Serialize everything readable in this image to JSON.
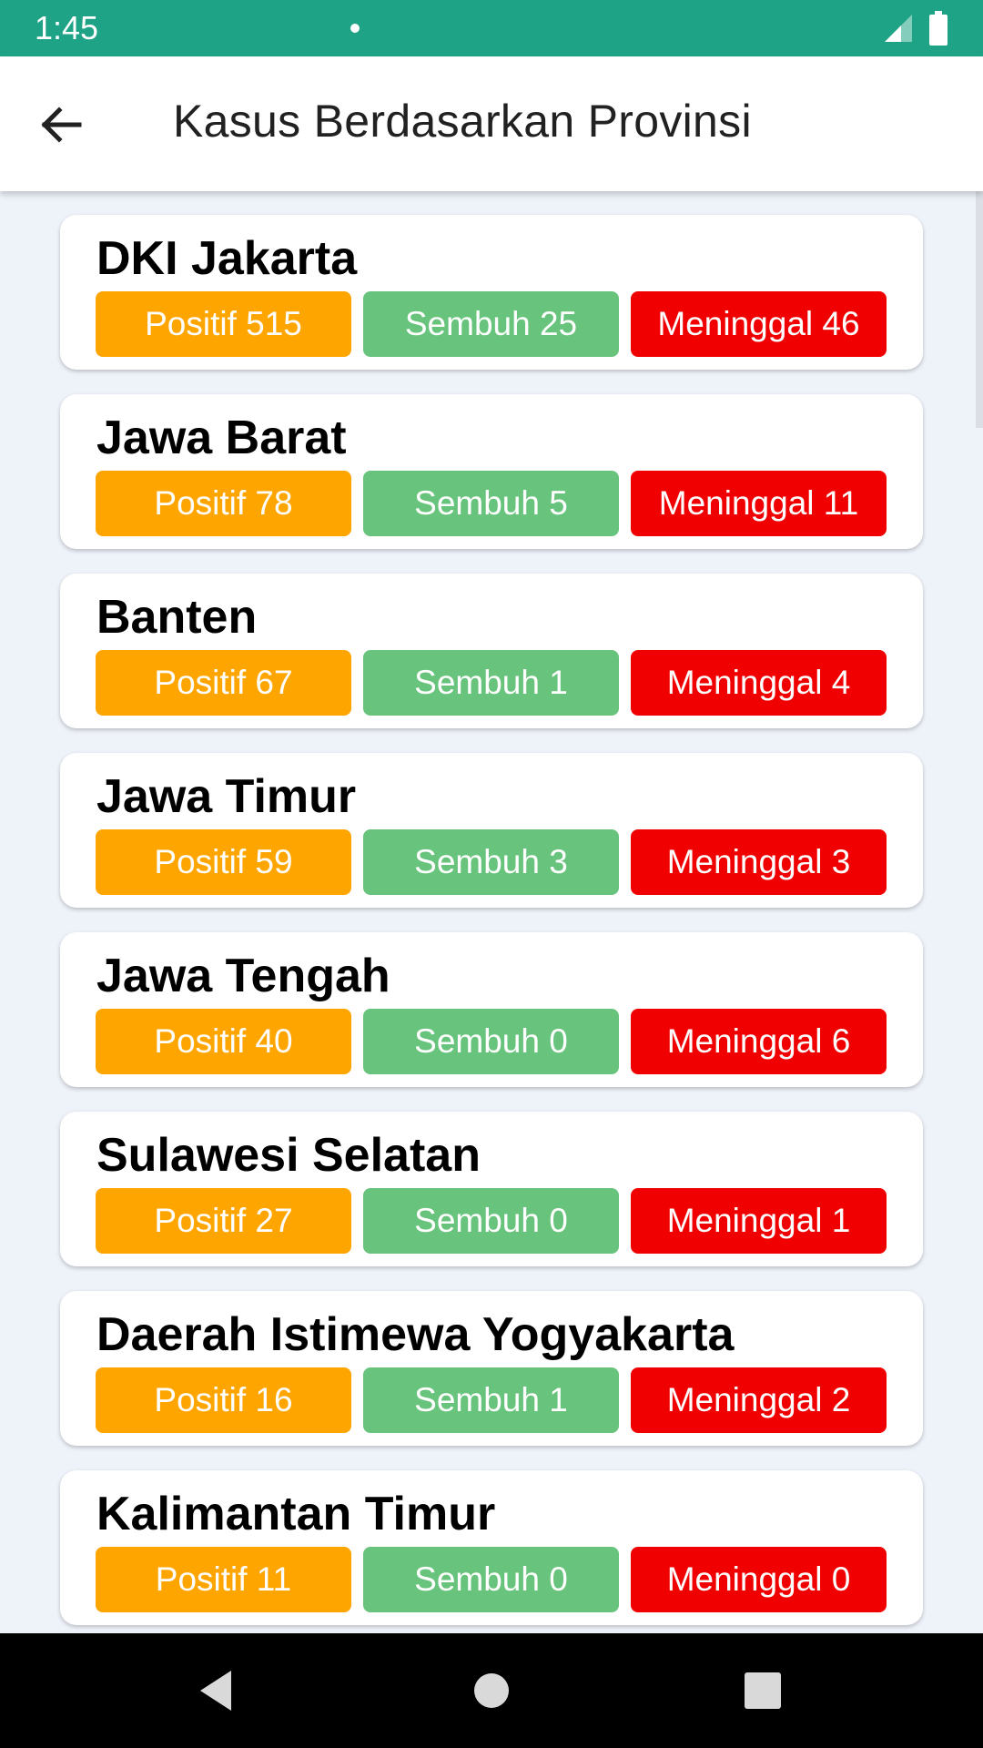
{
  "status_bar": {
    "time": "1:45",
    "icons": [
      "notification-dot-icon",
      "signal-icon",
      "battery-icon"
    ]
  },
  "app_bar": {
    "back_icon": "arrow-left-icon",
    "title": "Kasus Berdasarkan Provinsi"
  },
  "colors": {
    "status_bar": "#1fa386",
    "positive": "#ffa500",
    "recovered": "#68c47c",
    "deaths": "#f00000"
  },
  "provinces": [
    {
      "name": "DKI Jakarta",
      "positive": "Positif 515",
      "recovered": "Sembuh 25",
      "deaths": "Meninggal 46"
    },
    {
      "name": "Jawa Barat",
      "positive": "Positif 78",
      "recovered": "Sembuh 5",
      "deaths": "Meninggal 11"
    },
    {
      "name": "Banten",
      "positive": "Positif 67",
      "recovered": "Sembuh 1",
      "deaths": "Meninggal 4"
    },
    {
      "name": "Jawa Timur",
      "positive": "Positif 59",
      "recovered": "Sembuh 3",
      "deaths": "Meninggal 3"
    },
    {
      "name": "Jawa Tengah",
      "positive": "Positif 40",
      "recovered": "Sembuh 0",
      "deaths": "Meninggal 6"
    },
    {
      "name": "Sulawesi Selatan",
      "positive": "Positif 27",
      "recovered": "Sembuh 0",
      "deaths": "Meninggal 1"
    },
    {
      "name": "Daerah Istimewa Yogyakarta",
      "positive": "Positif 16",
      "recovered": "Sembuh 1",
      "deaths": "Meninggal 2"
    },
    {
      "name": "Kalimantan Timur",
      "positive": "Positif 11",
      "recovered": "Sembuh 0",
      "deaths": "Meninggal 0"
    }
  ],
  "nav_bar": {
    "icons": [
      "back-triangle-icon",
      "home-circle-icon",
      "recents-square-icon"
    ]
  }
}
